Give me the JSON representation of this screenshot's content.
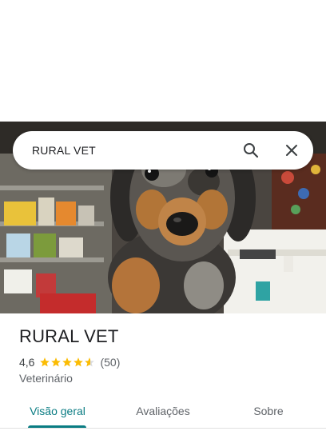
{
  "search": {
    "query": "RURAL VET"
  },
  "place": {
    "name": "RURAL VET",
    "rating": "4,6",
    "rating_value": 4.6,
    "review_count": "(50)",
    "category": "Veterinário"
  },
  "tabs": [
    {
      "label": "Visão geral",
      "active": true
    },
    {
      "label": "Avaliações",
      "active": false
    },
    {
      "label": "Sobre",
      "active": false
    }
  ],
  "colors": {
    "accent": "#0a7c83",
    "star": "#fbbc04",
    "title": "#202124",
    "secondary": "#5f6368"
  },
  "icons": {
    "search": "search-icon",
    "close": "close-icon",
    "star": "star-icon"
  }
}
